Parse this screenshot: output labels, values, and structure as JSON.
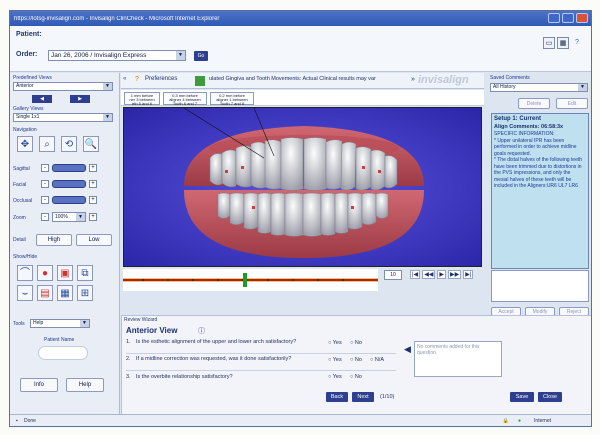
{
  "window": {
    "title": "https://lotsg-invisalign.com - Invisalign ClinCheck - Microsoft Internet Explorer"
  },
  "header": {
    "patient_label": "Patient:",
    "order_label": "Order:",
    "order_value": "Jan 26, 2006 / Invisalign Express",
    "go_label": "Go"
  },
  "left_panel": {
    "predefined_views_label": "Predefined Views",
    "predefined_views_value": "Anterior",
    "gallery_views_label": "Gallery Views",
    "gallery_views_value": "Single 1x1",
    "navigation_label": "Navigation",
    "sagittal_label": "Sagittal",
    "facial_label": "Facial",
    "occlusal_label": "Occlusal",
    "zoom_label": "Zoom",
    "zoom_value": "100%",
    "detail_label": "Detail",
    "detail_high": "High",
    "detail_low": "Low",
    "show_hide_label": "Show/Hide",
    "tools_label": "Tools",
    "tools_value": "Help",
    "patient_name_label": "Patient Name",
    "info_button": "Info",
    "help_button": "Help"
  },
  "center": {
    "preferences_label": "Preferences",
    "tab_text": "ulated Gingiva and Tooth Movements: Actual Clinical results may var",
    "logo_text": "invisalign",
    "stages": [
      {
        "lines": [
          "1 mm before",
          "ner 3 between",
          "eth 5 and 6"
        ]
      },
      {
        "lines": [
          "0.3 mm before",
          "aligner 4 between",
          "Tooth 6 and 7"
        ]
      },
      {
        "lines": [
          "0.2 mm before",
          "aligner 1 between",
          "Tooth 7 and 8"
        ]
      }
    ],
    "stage_number": "10"
  },
  "right_panel": {
    "saved_comments_label": "Saved Comments",
    "history_value": "All History",
    "button_delete": "Delete",
    "button_edit": "Edit",
    "comment_title": "Setup 1: Current",
    "comment_header": "Align Comments: 06:58:3x",
    "comment_body": "SPECIFIC INFORMATION:\n* Upper unilateral IPR has been performed in order to achieve midline goals requested.\n* The distal halves of the following teeth have been trimmed due to distortions in the PVS impressions, and only the mesial halves of these teeth will be included in the Aligners:UR6 UL7 LR6",
    "action_buttons": [
      "Accept",
      "Modify",
      "Reject"
    ]
  },
  "review": {
    "title": "Review Wizard",
    "view_label": "Anterior View",
    "questions": [
      {
        "number": "1.",
        "text": "Is the esthetic alignment of the upper and lower arch satisfactory?",
        "options": [
          "Yes",
          "No"
        ]
      },
      {
        "number": "2.",
        "text": "If a midline correction was requested, was it done satisfactorily?",
        "options": [
          "Yes",
          "No",
          "N/A"
        ]
      },
      {
        "number": "3.",
        "text": "Is the overbite relationship satisfactory?",
        "options": [
          "Yes",
          "No"
        ]
      }
    ],
    "note_text": "No comments added for this question.",
    "back_label": "Back",
    "next_label": "Next",
    "progress": "(1/10)",
    "submit_label": "Save",
    "close_label": "Close"
  },
  "status": {
    "left": "Done",
    "right": "Internet"
  }
}
